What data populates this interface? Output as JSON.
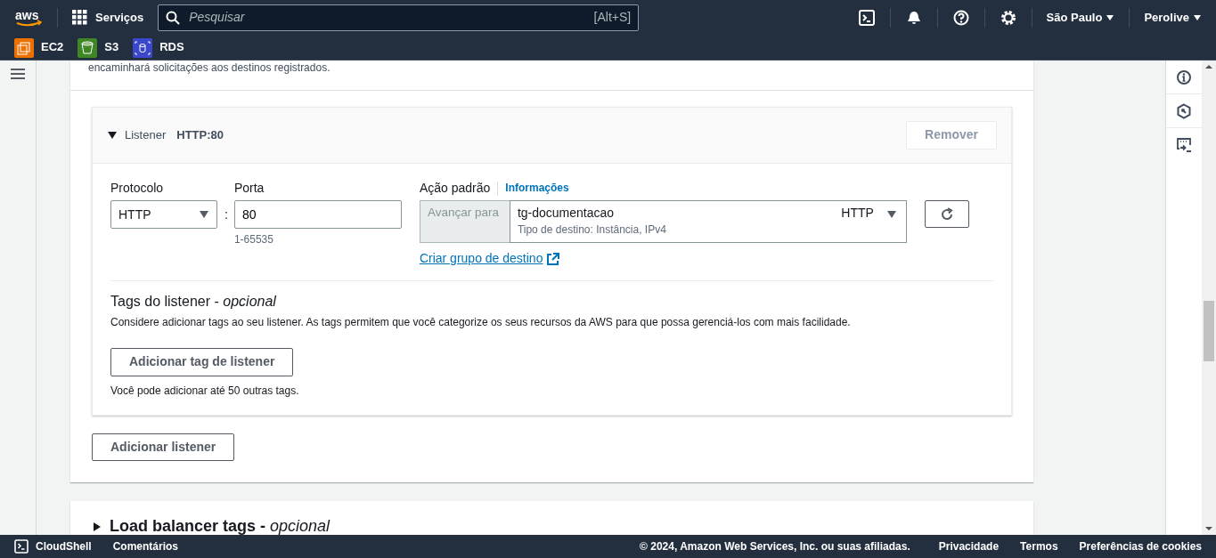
{
  "header": {
    "logo": "aws",
    "services_label": "Serviços",
    "search": {
      "placeholder": "Pesquisar",
      "shortcut": "[Alt+S]"
    },
    "region": "São Paulo",
    "account": "Perolive"
  },
  "favorites": [
    {
      "label": "EC2",
      "kind": "compute",
      "color": "#ed7100"
    },
    {
      "label": "S3",
      "kind": "storage",
      "color": "#3f8624"
    },
    {
      "label": "RDS",
      "kind": "database",
      "color": "#3b48cc"
    }
  ],
  "listeners_section": {
    "intro_text": "encaminhará solicitações aos destinos registrados.",
    "listener": {
      "label": "Listener",
      "name": "HTTP:80",
      "expanded": true,
      "remove_button": {
        "label": "Remover",
        "disabled": true
      },
      "protocol": {
        "label": "Protocolo",
        "value": "HTTP"
      },
      "port_separator": ":",
      "port": {
        "label": "Porta",
        "value": "80",
        "hint": "1-65535"
      },
      "default_action": {
        "label": "Ação padrão",
        "info_link": "Informações",
        "action_type": "Avançar para",
        "target_group": "tg-documentacao",
        "target_protocol": "HTTP",
        "target_detail": "Tipo de destino: Instância, IPv4",
        "create_link": "Criar grupo de destino"
      },
      "tags": {
        "title": "Tags do listener - *opcional*",
        "description": "Considere adicionar tags ao seu listener. As tags permitem que você categorize os seus recursos da AWS para que possa gerenciá-los com mais facilidade.",
        "add_button": "Adicionar tag de listener",
        "hint": "Você pode adicionar até 50 outras tags."
      }
    },
    "add_listener_button": "Adicionar listener"
  },
  "load_balancer_tags": {
    "title": "Load balancer tags - *opcional*",
    "expanded": false
  },
  "footer": {
    "cloudshell": "CloudShell",
    "feedback": "Comentários",
    "copyright": "© 2024, Amazon Web Services, Inc. ou suas afiliadas.",
    "links": [
      "Privacidade",
      "Termos",
      "Preferências de cookies"
    ]
  }
}
